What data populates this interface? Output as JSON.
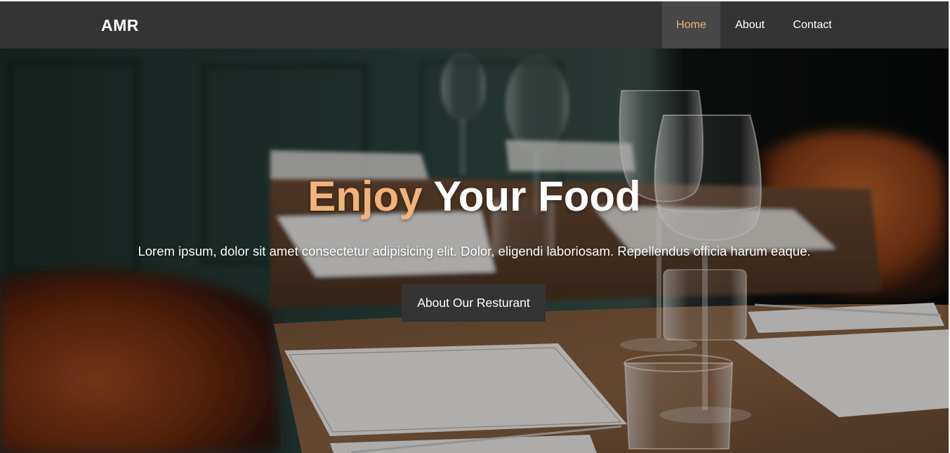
{
  "brand": {
    "name": "AMR"
  },
  "nav": {
    "items": [
      {
        "label": "Home",
        "active": true
      },
      {
        "label": "About",
        "active": false
      },
      {
        "label": "Contact",
        "active": false
      }
    ]
  },
  "hero": {
    "title_accent": "Enjoy",
    "title_rest": "Your Food",
    "subtitle": "Lorem ipsum, dolor sit amet consectetur adipisicing elit. Dolor, eligendi laboriosam. Repellendus officia harum eaque.",
    "button_label": "About Our Resturant",
    "background_image": "restaurant table with wine glasses"
  },
  "colors": {
    "accent": "#f2b27a",
    "navbar": "#343434",
    "nav_active_bg": "#474747",
    "button_bg": "#343434",
    "text": "#ffffff"
  }
}
